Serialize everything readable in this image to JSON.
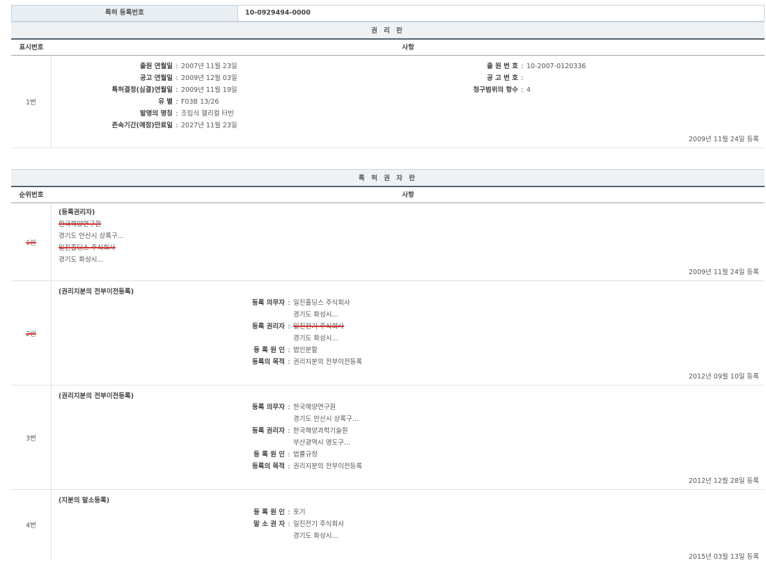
{
  "header": {
    "label": "특허 등록번호",
    "value": "10-0929494-0000"
  },
  "rights_section": {
    "title": "권 리 란",
    "col_num": "표시번호",
    "col_content": "사항",
    "row": {
      "num": "1번",
      "left": [
        {
          "k": "출원 연월일",
          "v": "2007년 11월 23일"
        },
        {
          "k": "공고 연월일",
          "v": "2009년 12월 03일"
        },
        {
          "k": "특허결정(심결)연월일",
          "v": "2009년 11월 19일"
        },
        {
          "k": "유 별",
          "v": "F03B 13/26"
        },
        {
          "k": "발명의 명칭",
          "v": "조립식 헬리컬 터빈"
        },
        {
          "k": "존속기간(예정)만료일",
          "v": "2027년 11월 23일"
        }
      ],
      "right": [
        {
          "k": "출 원 번 호",
          "v": "10-2007-0120336"
        },
        {
          "k": "공 고 번 호",
          "v": ""
        },
        {
          "k": "청구범위의 항수",
          "v": "4"
        }
      ],
      "date": "2009년 11월 24일 등록"
    }
  },
  "holder_section": {
    "title": "특 허 권 자 란",
    "col_num": "순위번호",
    "col_content": "사항",
    "rows": [
      {
        "num": "1번",
        "heading": "(등록권리자)",
        "lines": [
          "한국해양연구원",
          "경기도 안산시 상록구...",
          "일진홀딩스 주식회사",
          "경기도 화성시..."
        ],
        "date": "2009년 11월 24일 등록"
      },
      {
        "num": "2번",
        "heading": "(권리지분의 전부이전등록)",
        "items": [
          {
            "k": "등록 의무자",
            "v": "일진홀딩스 주식회사"
          },
          {
            "k": "",
            "v": "경기도 화성시..."
          },
          {
            "k": "등록 권리자",
            "v": "일진전기 주식회사"
          },
          {
            "k": "",
            "v": "경기도 화성시..."
          },
          {
            "k": "등 록 원 인",
            "v": "법인분할"
          },
          {
            "k": "등록의 목적",
            "v": "권리지분의 전부이전등록"
          }
        ],
        "date": "2012년 09월 10일 등록"
      },
      {
        "num": "3번",
        "heading": "(권리지분의 전부이전등록)",
        "items": [
          {
            "k": "등록 의무자",
            "v": "한국해양연구원"
          },
          {
            "k": "",
            "v": "경기도 안산시 상록구..."
          },
          {
            "k": "등록 권리자",
            "v": "한국해양과학기술원"
          },
          {
            "k": "",
            "v": "부산광역시 영도구..."
          },
          {
            "k": "등 록 원 인",
            "v": "법률규정"
          },
          {
            "k": "등록의 목적",
            "v": "권리지분의 전부이전등록"
          }
        ],
        "date": "2012년 12월 28일 등록"
      },
      {
        "num": "4번",
        "heading": "(지분의 말소등록)",
        "items": [
          {
            "k": "등 록 원 인",
            "v": "포기"
          },
          {
            "k": "말 소 권 자",
            "v": "일진전기 주식회사"
          },
          {
            "k": "",
            "v": "경기도 화성시..."
          }
        ],
        "date": "2015년 03월 13일 등록"
      }
    ]
  }
}
